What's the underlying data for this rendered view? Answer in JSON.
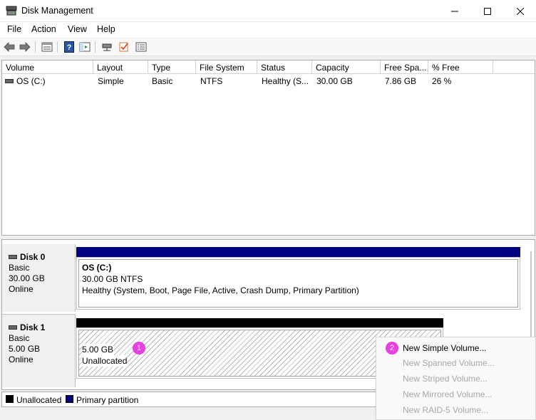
{
  "window": {
    "title": "Disk Management"
  },
  "menu": [
    "File",
    "Action",
    "View",
    "Help"
  ],
  "toolbar_icons": [
    "back-arrow-icon",
    "forward-arrow-icon",
    "properties-icon",
    "help-icon",
    "console-icon",
    "connect-icon",
    "check-icon",
    "list-icon"
  ],
  "volume_table": {
    "columns": [
      "Volume",
      "Layout",
      "Type",
      "File System",
      "Status",
      "Capacity",
      "Free Spa...",
      "% Free"
    ],
    "rows": [
      {
        "volume": "OS (C:)",
        "layout": "Simple",
        "type": "Basic",
        "file_system": "NTFS",
        "status": "Healthy (S...",
        "capacity": "30.00 GB",
        "free_space": "7.86 GB",
        "percent_free": "26 %"
      }
    ]
  },
  "disks": [
    {
      "name": "Disk 0",
      "type": "Basic",
      "size": "30.00 GB",
      "status": "Online",
      "partition": {
        "label": "OS  (C:)",
        "size_fs": "30.00 GB NTFS",
        "health": "Healthy (System, Boot, Page File, Active, Crash Dump, Primary Partition)"
      }
    },
    {
      "name": "Disk 1",
      "type": "Basic",
      "size": "5.00 GB",
      "status": "Online",
      "partition": {
        "size": "5.00 GB",
        "state": "Unallocated"
      }
    }
  ],
  "legend": [
    {
      "label": "Unallocated",
      "color": "#000000"
    },
    {
      "label": "Primary partition",
      "color": "#000080"
    }
  ],
  "context_menu": {
    "items": [
      {
        "label": "New Simple Volume...",
        "enabled": true
      },
      {
        "label": "New Spanned Volume...",
        "enabled": false
      },
      {
        "label": "New Striped Volume...",
        "enabled": false
      },
      {
        "label": "New Mirrored Volume...",
        "enabled": false
      },
      {
        "label": "New RAID-5 Volume...",
        "enabled": false
      }
    ]
  },
  "badges": [
    "1",
    "2"
  ],
  "colors": {
    "primary_partition": "#000080",
    "unallocated": "#000000",
    "badge": "#e83fe0"
  }
}
